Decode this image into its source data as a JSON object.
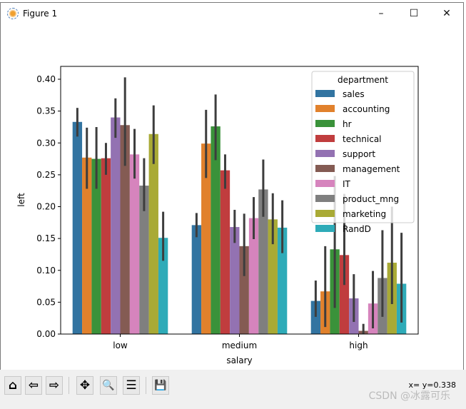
{
  "window": {
    "title": "Figure 1",
    "minimize": "–",
    "maximize": "☐",
    "close": "✕"
  },
  "toolbar": {
    "buttons": [
      {
        "name": "home-icon",
        "glyph": "⌂"
      },
      {
        "name": "back-icon",
        "glyph": "⇦"
      },
      {
        "name": "forward-icon",
        "glyph": "⇨"
      },
      {
        "name": "pan-icon",
        "glyph": "✥"
      },
      {
        "name": "zoom-icon",
        "glyph": "🔍"
      },
      {
        "name": "configure-subplots-icon",
        "glyph": "☰"
      },
      {
        "name": "save-icon",
        "glyph": "💾"
      }
    ],
    "coords": "x= y=0.338"
  },
  "watermark": "CSDN @冰露可乐",
  "chart_data": {
    "type": "bar",
    "title": "",
    "xlabel": "salary",
    "ylabel": "left",
    "ylim": [
      0,
      0.4
    ],
    "yticks": [
      "0.00",
      "0.05",
      "0.10",
      "0.15",
      "0.20",
      "0.25",
      "0.30",
      "0.35",
      "0.40"
    ],
    "categories": [
      "low",
      "medium",
      "high"
    ],
    "legend": {
      "title": "department",
      "placement": "top-right"
    },
    "series": [
      {
        "name": "sales",
        "color": "#3274a1",
        "values": [
          0.333,
          0.171,
          0.052
        ],
        "ci": [
          [
            0.31,
            0.355
          ],
          [
            0.152,
            0.19
          ],
          [
            0.027,
            0.084
          ]
        ]
      },
      {
        "name": "accounting",
        "color": "#e1812c",
        "values": [
          0.277,
          0.299,
          0.067
        ],
        "ci": [
          [
            0.228,
            0.324
          ],
          [
            0.245,
            0.352
          ],
          [
            0.011,
            0.138
          ]
        ]
      },
      {
        "name": "hr",
        "color": "#3a923a",
        "values": [
          0.275,
          0.326,
          0.133
        ],
        "ci": [
          [
            0.228,
            0.325
          ],
          [
            0.273,
            0.376
          ],
          [
            0.041,
            0.248
          ]
        ]
      },
      {
        "name": "technical",
        "color": "#c03d3e",
        "values": [
          0.276,
          0.257,
          0.124
        ],
        "ci": [
          [
            0.25,
            0.3
          ],
          [
            0.228,
            0.282
          ],
          [
            0.077,
            0.22
          ]
        ]
      },
      {
        "name": "support",
        "color": "#9372b2",
        "values": [
          0.34,
          0.168,
          0.056
        ],
        "ci": [
          [
            0.308,
            0.37
          ],
          [
            0.143,
            0.195
          ],
          [
            0.019,
            0.094
          ]
        ]
      },
      {
        "name": "management",
        "color": "#845b53",
        "values": [
          0.328,
          0.138,
          0.005
        ],
        "ci": [
          [
            0.264,
            0.403
          ],
          [
            0.091,
            0.189
          ],
          [
            0.0,
            0.016
          ]
        ]
      },
      {
        "name": "IT",
        "color": "#d684bd",
        "values": [
          0.282,
          0.182,
          0.048
        ],
        "ci": [
          [
            0.244,
            0.322
          ],
          [
            0.149,
            0.215
          ],
          [
            0.009,
            0.099
          ]
        ]
      },
      {
        "name": "product_mng",
        "color": "#7f7f7f",
        "values": [
          0.233,
          0.227,
          0.088
        ],
        "ci": [
          [
            0.193,
            0.276
          ],
          [
            0.184,
            0.274
          ],
          [
            0.027,
            0.163
          ]
        ]
      },
      {
        "name": "marketing",
        "color": "#a9aa35",
        "values": [
          0.314,
          0.18,
          0.112
        ],
        "ci": [
          [
            0.267,
            0.359
          ],
          [
            0.141,
            0.221
          ],
          [
            0.047,
            0.2
          ]
        ]
      },
      {
        "name": "RandD",
        "color": "#2eabb8",
        "values": [
          0.151,
          0.167,
          0.079
        ],
        "ci": [
          [
            0.115,
            0.192
          ],
          [
            0.127,
            0.21
          ],
          [
            0.018,
            0.159
          ]
        ]
      }
    ]
  }
}
